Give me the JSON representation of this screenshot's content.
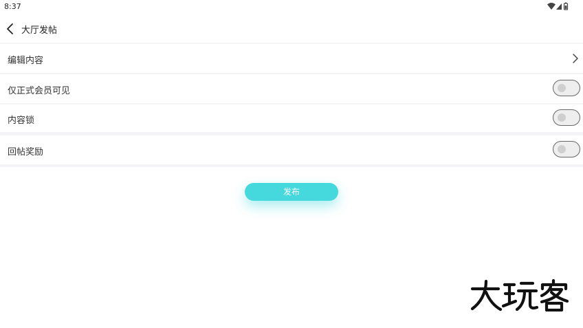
{
  "status_bar": {
    "time": "8:37",
    "icons": [
      "wifi-icon",
      "signal-icon",
      "battery-icon"
    ]
  },
  "app_bar": {
    "back_icon": "back-arrow-icon",
    "title": "大厅发帖"
  },
  "rows": [
    {
      "label": "编辑内容",
      "control": "chevron-right-icon"
    },
    {
      "label": "仅正式会员可见",
      "control": "toggle",
      "checked": false
    },
    {
      "label": "内容锁",
      "control": "toggle",
      "checked": false
    },
    {
      "label": "回帖奖励",
      "control": "toggle",
      "checked": false
    }
  ],
  "publish_button": {
    "label": "发布",
    "color": "#45d8dd"
  },
  "watermark": {
    "text": "大玩客"
  },
  "colors": {
    "background": "#ffffff",
    "separator": "#f4f4f6",
    "accent": "#45d8dd",
    "toggle_border": "#666666",
    "toggle_knob": "#cfcfcf"
  }
}
